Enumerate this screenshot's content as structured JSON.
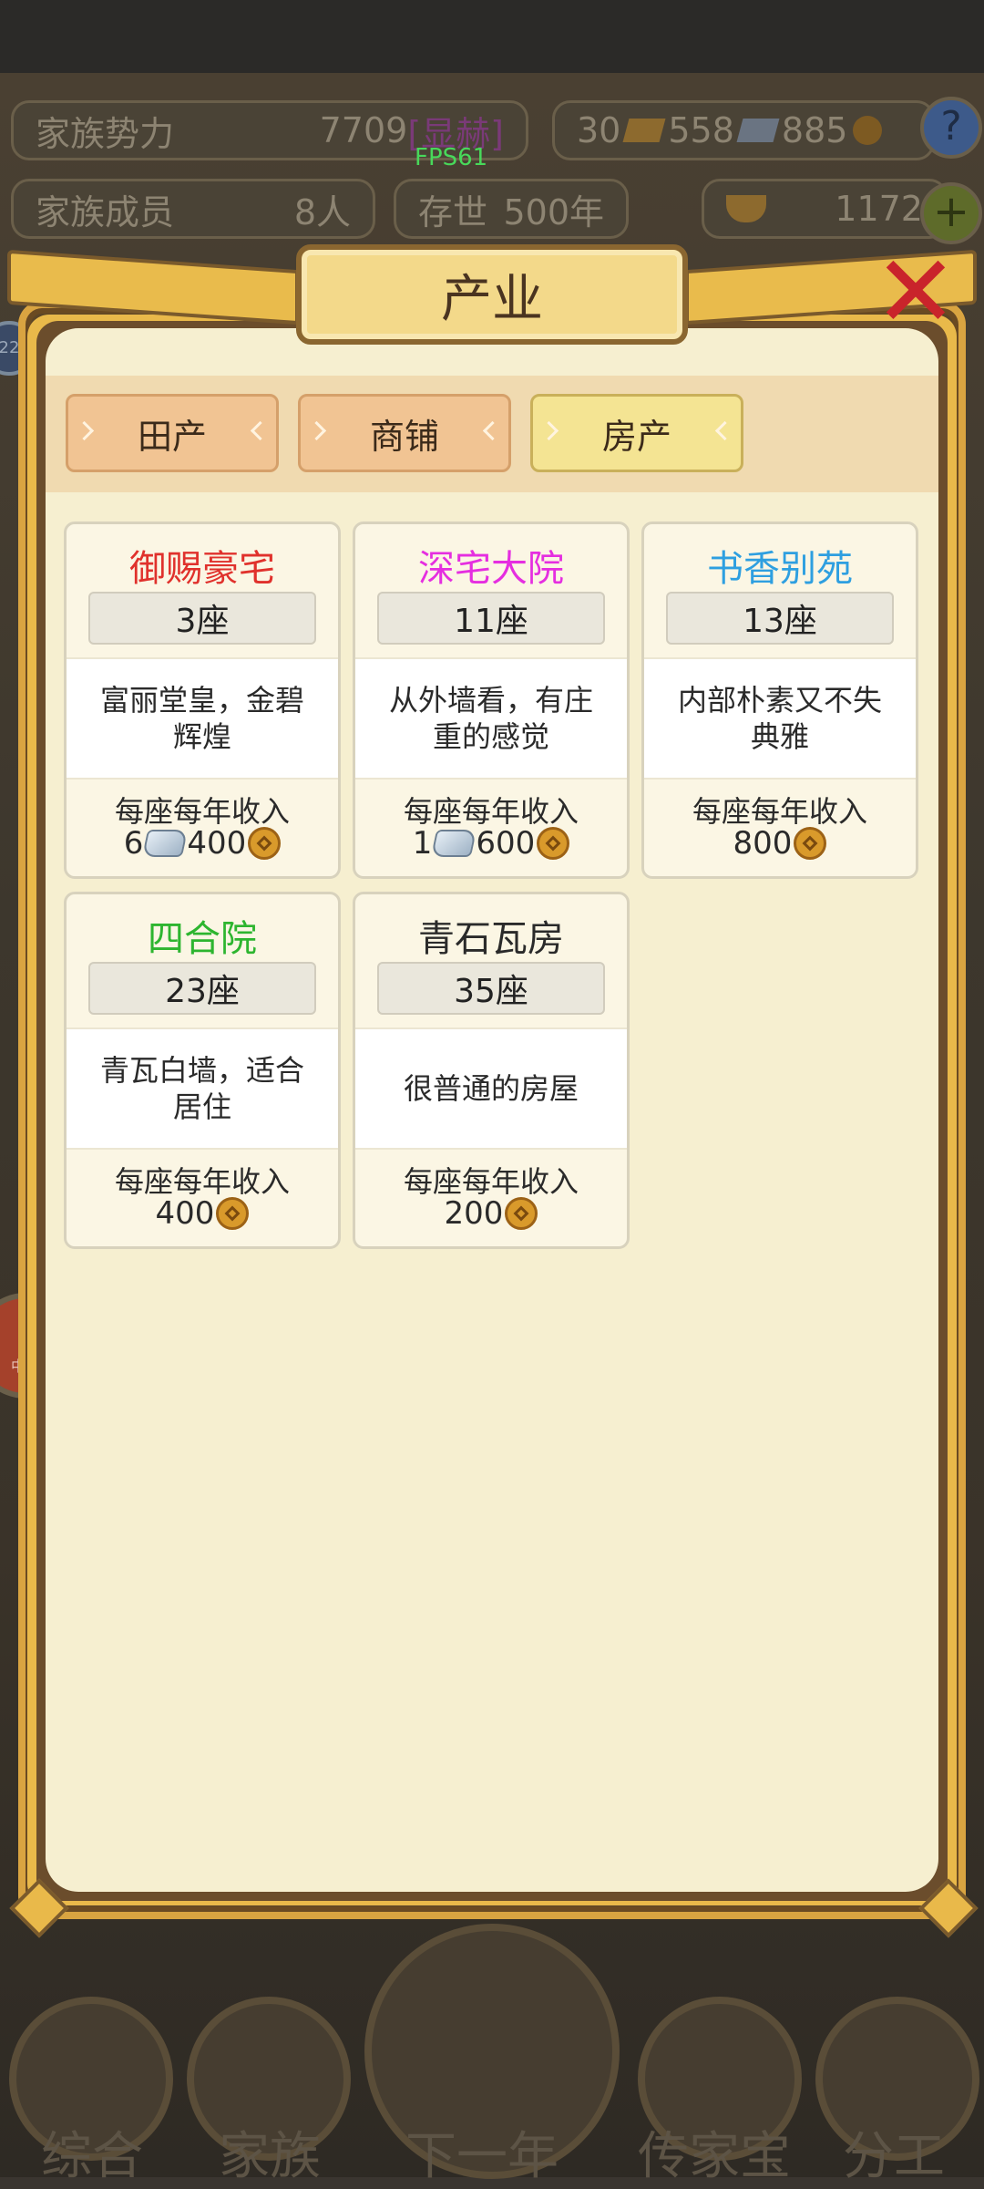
{
  "hud": {
    "family_power_label": "家族势力",
    "family_power_value": "7709",
    "family_power_rank": "[显赫]",
    "currency_gold": "30",
    "currency_silver": "558",
    "currency_coin": "885",
    "help_icon": "?",
    "members_label": "家族成员",
    "members_value": "8人",
    "survival_label": "存世",
    "survival_value": "500年",
    "ingot_value": "1172",
    "add_icon": "+",
    "fps": "FPS61",
    "left_badge": "22",
    "left_avatar_label": "中国"
  },
  "bottom_nav": [
    {
      "label": "综合",
      "icon": "scroll-icon"
    },
    {
      "label": "家族",
      "icon": "hall-icon"
    },
    {
      "label": "下一年",
      "icon": "mountain-icon"
    },
    {
      "label": "传家宝",
      "icon": "treasure-icon"
    },
    {
      "label": "分工",
      "icon": "people-icon"
    }
  ],
  "panel": {
    "title": "产业",
    "close_icon": "close-icon",
    "tabs": [
      {
        "label": "田产",
        "active": false
      },
      {
        "label": "商铺",
        "active": false
      },
      {
        "label": "房产",
        "active": true
      }
    ],
    "income_label": "每座每年收入",
    "properties": [
      {
        "name": "御赐豪宅",
        "color": "#e0312c",
        "count": "3座",
        "desc": "富丽堂皇，金碧辉煌",
        "silver": "6",
        "coins": "400"
      },
      {
        "name": "深宅大院",
        "color": "#e52ee0",
        "count": "11座",
        "desc": "从外墙看，有庄重的感觉",
        "silver": "1",
        "coins": "600"
      },
      {
        "name": "书香别苑",
        "color": "#2e9fe0",
        "count": "13座",
        "desc": "内部朴素又不失典雅",
        "silver": "",
        "coins": "800"
      },
      {
        "name": "四合院",
        "color": "#2db52f",
        "count": "23座",
        "desc": "青瓦白墙，适合居住",
        "silver": "",
        "coins": "400"
      },
      {
        "name": "青石瓦房",
        "color": "#2a2a2a",
        "count": "35座",
        "desc": "很普通的房屋",
        "silver": "",
        "coins": "200"
      }
    ]
  }
}
